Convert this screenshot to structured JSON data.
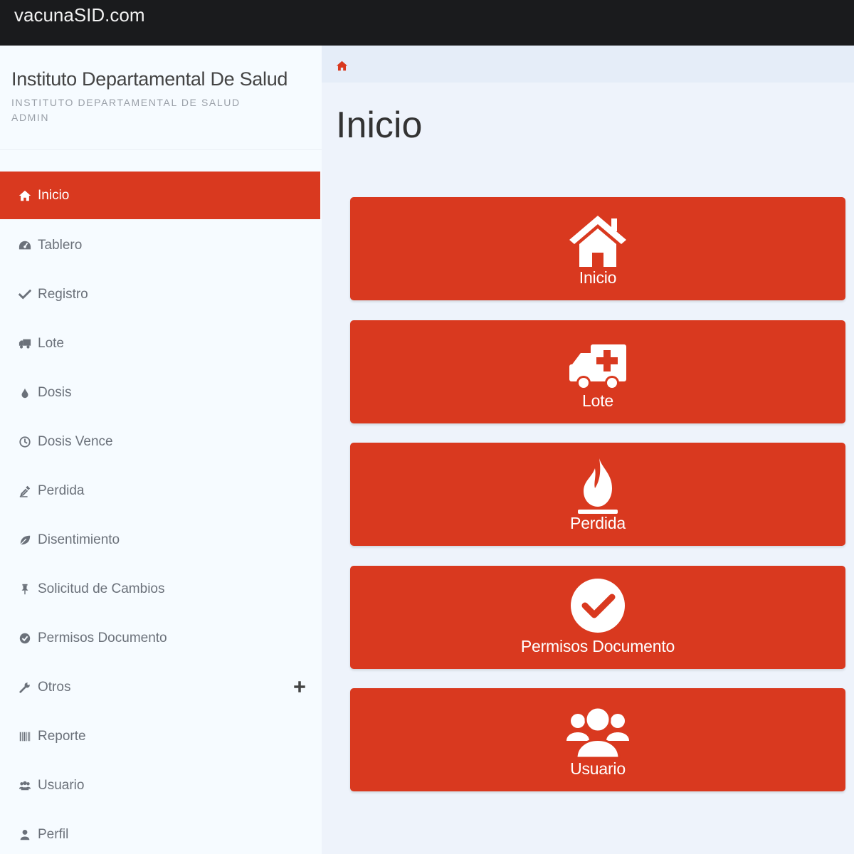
{
  "app": {
    "brand": "vacunaSID.com"
  },
  "sidebar": {
    "org_title": "Instituto Departamental De Salud",
    "org_subtitle": "INSTITUTO DEPARTAMENTAL DE SALUD",
    "role": "ADMIN",
    "items": [
      {
        "label": "Inicio",
        "icon": "home-icon",
        "active": true
      },
      {
        "label": "Tablero",
        "icon": "dashboard-icon"
      },
      {
        "label": "Registro",
        "icon": "check-icon"
      },
      {
        "label": "Lote",
        "icon": "truck-icon"
      },
      {
        "label": "Dosis",
        "icon": "droplet-icon"
      },
      {
        "label": "Dosis Vence",
        "icon": "clock-icon"
      },
      {
        "label": "Perdida",
        "icon": "eyedropper-icon"
      },
      {
        "label": "Disentimiento",
        "icon": "leaf-icon"
      },
      {
        "label": "Solicitud de Cambios",
        "icon": "pushpin-icon"
      },
      {
        "label": "Permisos Documento",
        "icon": "check-circle-icon"
      },
      {
        "label": "Otros",
        "icon": "wrench-icon",
        "expandable": true
      },
      {
        "label": "Reporte",
        "icon": "barcode-icon"
      },
      {
        "label": "Usuario",
        "icon": "users-icon"
      },
      {
        "label": "Perfil",
        "icon": "user-icon"
      }
    ]
  },
  "main": {
    "breadcrumb_icon": "home-icon",
    "title": "Inicio",
    "tiles": [
      {
        "label": "Inicio",
        "icon": "home-icon"
      },
      {
        "label": "Lote",
        "icon": "ambulance-icon"
      },
      {
        "label": "Perdida",
        "icon": "fire-icon"
      },
      {
        "label": "Permisos Documento",
        "icon": "check-circle-icon"
      },
      {
        "label": "Usuario",
        "icon": "users-icon"
      }
    ]
  },
  "colors": {
    "accent": "#d9391f",
    "topbar": "#1a1b1d",
    "sidebar_bg": "#f6fbff",
    "main_bg": "#eef3fb"
  }
}
